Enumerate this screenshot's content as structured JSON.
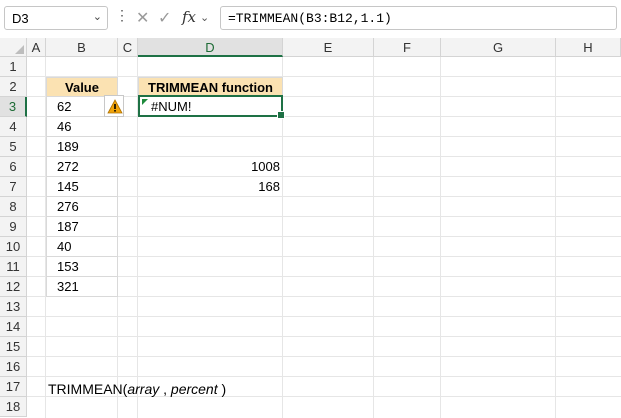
{
  "formula_bar": {
    "name_box": "D3",
    "formula": "=TRIMMEAN(B3:B12,1.1)",
    "fx_label": "fx"
  },
  "columns": [
    "A",
    "B",
    "C",
    "D",
    "E",
    "F",
    "G",
    "H"
  ],
  "rows": [
    "1",
    "2",
    "3",
    "4",
    "5",
    "6",
    "7",
    "8",
    "9",
    "10",
    "11",
    "12",
    "13",
    "14",
    "15",
    "16",
    "17",
    "18"
  ],
  "selected_column": "D",
  "selected_row": "3",
  "table": {
    "value_header": "Value",
    "values": [
      "62",
      "46",
      "189",
      "272",
      "145",
      "276",
      "187",
      "40",
      "153",
      "321"
    ],
    "function_header": "TRIMMEAN function",
    "result": "#NUM!"
  },
  "extra_cells": {
    "d6": "1008",
    "d7": "168"
  },
  "syntax": {
    "function_name": "TRIMMEAN(",
    "arg1": "array",
    "separator": " , ",
    "arg2": "percent",
    "close": " )"
  },
  "colors": {
    "accent": "#1e7145",
    "header_fill": "#fbe2b2",
    "warning": "#f0a30a"
  }
}
